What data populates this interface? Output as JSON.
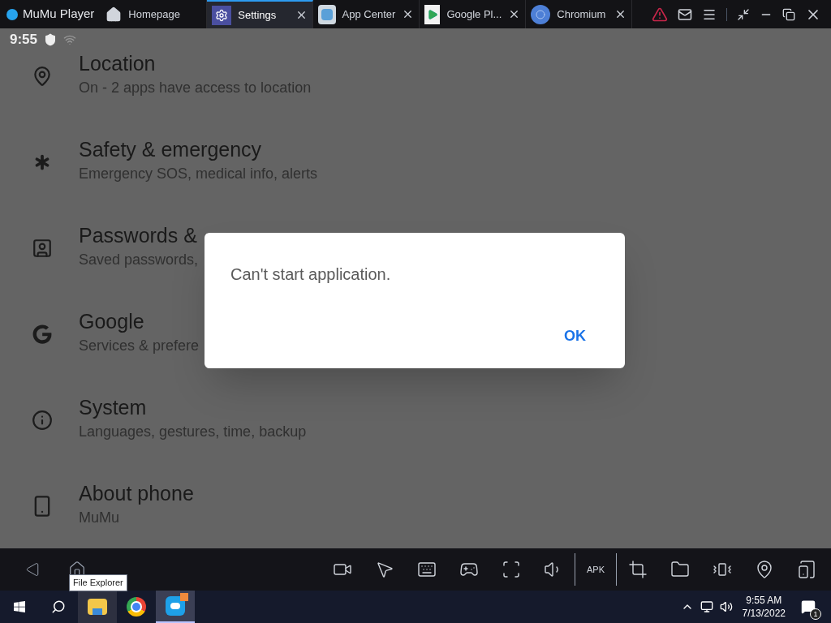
{
  "title_bar": {
    "app_name": "MuMu Player",
    "tabs": [
      {
        "label": "Homepage",
        "kind": "home",
        "selected": false,
        "closable": false
      },
      {
        "label": "Settings",
        "kind": "settings",
        "selected": true,
        "closable": true
      },
      {
        "label": "App Center",
        "kind": "appcenter",
        "selected": false,
        "closable": true
      },
      {
        "label": "Google Pl...",
        "kind": "play",
        "selected": false,
        "closable": true
      },
      {
        "label": "Chromium",
        "kind": "chromium",
        "selected": false,
        "closable": true
      }
    ]
  },
  "status_bar": {
    "time": "9:55"
  },
  "settings": [
    {
      "kind": "location",
      "title": "Location",
      "subtitle": "On - 2 apps have access to location"
    },
    {
      "kind": "safety",
      "title": "Safety & emergency",
      "subtitle": "Emergency SOS, medical info, alerts"
    },
    {
      "kind": "passwords",
      "title": "Passwords &",
      "subtitle": "Saved passwords,"
    },
    {
      "kind": "google",
      "title": "Google",
      "subtitle": "Services & prefere"
    },
    {
      "kind": "system",
      "title": "System",
      "subtitle": "Languages, gestures, time, backup"
    },
    {
      "kind": "about",
      "title": "About phone",
      "subtitle": "MuMu"
    }
  ],
  "dialog": {
    "message": "Can't start application.",
    "button": "OK"
  },
  "nav_bar": {
    "tooltip": "File Explorer",
    "tools": [
      {
        "kind": "record"
      },
      {
        "kind": "macro"
      },
      {
        "kind": "keyboard"
      },
      {
        "kind": "gamepad"
      },
      {
        "kind": "fullscreen"
      },
      {
        "kind": "volume"
      },
      {
        "kind": "apk",
        "label": "APK"
      },
      {
        "kind": "crop"
      },
      {
        "kind": "folder"
      },
      {
        "kind": "shake"
      },
      {
        "kind": "location"
      },
      {
        "kind": "multi"
      }
    ]
  },
  "taskbar": {
    "apps": [
      {
        "kind": "explorer",
        "hovered": true,
        "selected": false
      },
      {
        "kind": "chrome",
        "hovered": false,
        "selected": false
      },
      {
        "kind": "mumu",
        "hovered": false,
        "selected": true
      }
    ],
    "time": "9:55 AM",
    "date": "7/13/2022",
    "notifications": "1"
  }
}
